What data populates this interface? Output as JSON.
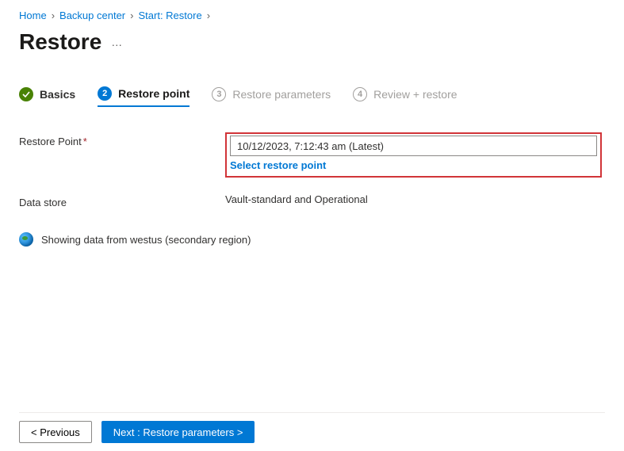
{
  "breadcrumb": {
    "items": [
      "Home",
      "Backup center",
      "Start: Restore"
    ]
  },
  "title": "Restore",
  "steps": {
    "s1": {
      "label": "Basics"
    },
    "s2": {
      "num": "2",
      "label": "Restore point"
    },
    "s3": {
      "num": "3",
      "label": "Restore parameters"
    },
    "s4": {
      "num": "4",
      "label": "Review + restore"
    }
  },
  "form": {
    "restore_point_label": "Restore Point",
    "restore_point_value": "10/12/2023, 7:12:43 am (Latest)",
    "select_link": "Select restore point",
    "data_store_label": "Data store",
    "data_store_value": "Vault-standard and Operational"
  },
  "info_text": "Showing data from westus (secondary region)",
  "footer": {
    "prev": "<  Previous",
    "next": "Next : Restore parameters  >"
  }
}
